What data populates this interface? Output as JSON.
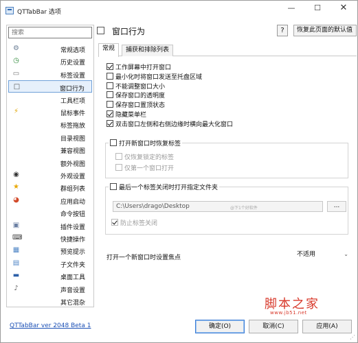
{
  "window": {
    "title": "QTTabBar 选项",
    "min": "—",
    "max": "☐",
    "close": "✕"
  },
  "sidebar": {
    "search_placeholder": "搜索",
    "items": [
      {
        "label": "常规选项",
        "icon": "⚙",
        "icon_name": "gear-icon",
        "color": "#6a7d94"
      },
      {
        "label": "历史设置",
        "icon": "◷",
        "icon_name": "history-icon",
        "color": "#2f8a3a"
      },
      {
        "label": "标签设置",
        "icon": "▭",
        "icon_name": "tab-icon",
        "color": "#777777"
      },
      {
        "label": "窗口行为",
        "icon": "□",
        "icon_name": "window-icon",
        "color": "#555555"
      },
      {
        "label": "工具栏项",
        "icon": "",
        "icon_name": "toolbar-icon",
        "color": "#555555"
      },
      {
        "label": "鼠标事件",
        "icon": "⚡",
        "icon_name": "lightning-icon",
        "color": "#e0a400"
      },
      {
        "label": "标签拖放",
        "icon": "",
        "icon_name": "drag-icon",
        "color": "#555555"
      },
      {
        "label": "目录视图",
        "icon": "",
        "icon_name": "folder-view-icon",
        "color": "#555555"
      },
      {
        "label": "兼容视图",
        "icon": "",
        "icon_name": "compat-view-icon",
        "color": "#555555"
      },
      {
        "label": "额外视图",
        "icon": "",
        "icon_name": "extra-view-icon",
        "color": "#555555"
      },
      {
        "label": "外观设置",
        "icon": "◉",
        "icon_name": "eye-icon",
        "color": "#333333"
      },
      {
        "label": "群组列表",
        "icon": "★",
        "icon_name": "star-icon",
        "color": "#e9a800"
      },
      {
        "label": "应用启动",
        "icon": "◕",
        "icon_name": "app-launch-icon",
        "color": "#d24a2a"
      },
      {
        "label": "命令按钮",
        "icon": "",
        "icon_name": "command-icon",
        "color": "#555555"
      },
      {
        "label": "插件设置",
        "icon": "▣",
        "icon_name": "plugin-icon",
        "color": "#6b7fa3"
      },
      {
        "label": "快捷操作",
        "icon": "⌨",
        "icon_name": "keyboard-icon",
        "color": "#444444"
      },
      {
        "label": "预览提示",
        "icon": "▦",
        "icon_name": "preview-icon",
        "color": "#4f86c6"
      },
      {
        "label": "子文件夹",
        "icon": "▤",
        "icon_name": "subfolder-icon",
        "color": "#4f86c6"
      },
      {
        "label": "桌面工具",
        "icon": "▬",
        "icon_name": "desktop-icon",
        "color": "#2c5fa8"
      },
      {
        "label": "声音设置",
        "icon": "♪",
        "icon_name": "sound-icon",
        "color": "#666666"
      },
      {
        "label": "其它混杂",
        "icon": "",
        "icon_name": "misc-icon",
        "color": "#555555"
      }
    ],
    "version_link": "QTTabBar ver 2048 Beta 1"
  },
  "page": {
    "title": "窗口行为",
    "help_label": "?",
    "restore_label": "恢复此页面的默认值",
    "tabs": [
      "常规",
      "捕获和排除列表"
    ],
    "options": [
      {
        "label": "工作屏幕中打开窗口",
        "checked": true
      },
      {
        "label": "最小化时将窗口发送至托盘区域",
        "checked": false
      },
      {
        "label": "不能调整窗口大小",
        "checked": false
      },
      {
        "label": "保存窗口的透明度",
        "checked": false
      },
      {
        "label": "保存窗口置顶状态",
        "checked": false
      },
      {
        "label": "隐藏菜单栏",
        "checked": true
      },
      {
        "label": "双击窗口左侧和右侧边缘时横向最大化窗口",
        "checked": true
      }
    ],
    "restore_group": {
      "title": "打开新窗口时恢复标签",
      "sub": [
        "仅恢复锁定的标签",
        "仅第一个窗口打开"
      ]
    },
    "folder_group": {
      "title": "最后一个标签关闭时打开指定文件夹",
      "path": "C:\\Users\\drago\\Desktop",
      "hint": "@下1个好软件",
      "browse": "...",
      "sub": "防止标签关闭"
    },
    "focus_label": "打开一个新窗口时设置焦点",
    "focus_value": "不适用",
    "focus_arrow": "⌄"
  },
  "footer": {
    "ok": "确定(O)",
    "cancel": "取消(C)",
    "apply": "应用(A)"
  },
  "watermark": {
    "text": "脚本之家",
    "url": "www.jb51.net"
  }
}
